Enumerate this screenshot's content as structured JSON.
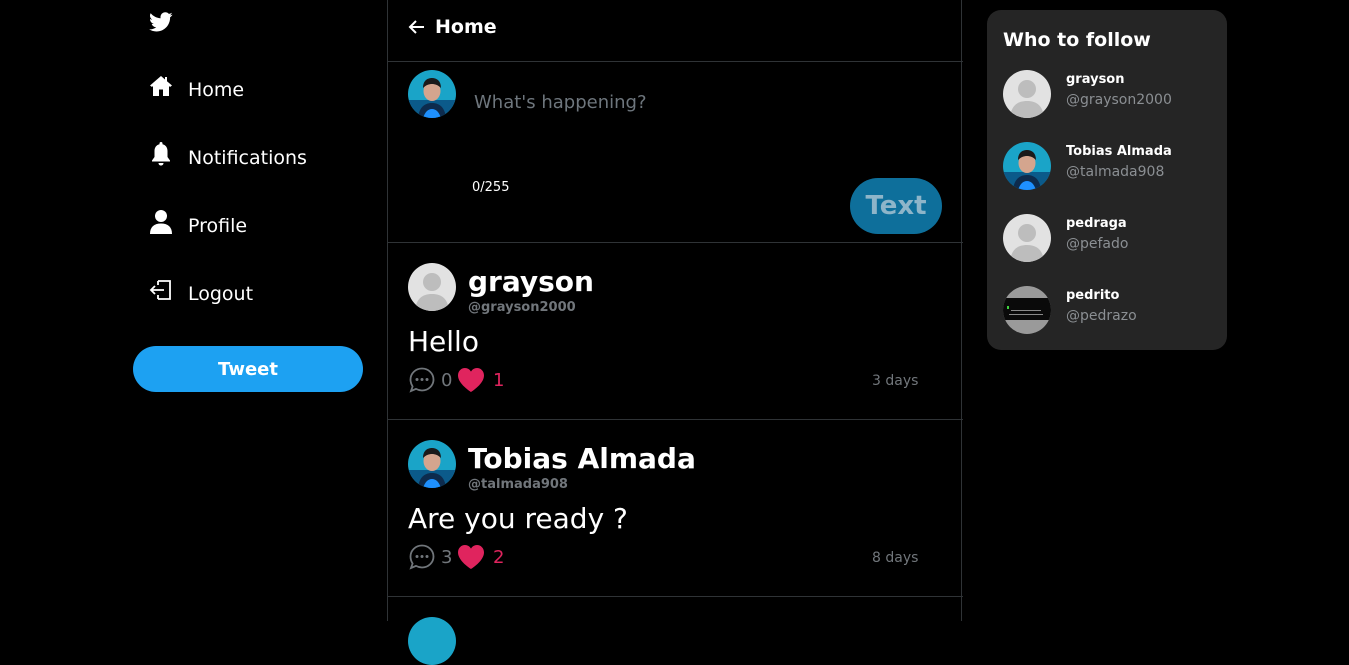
{
  "nav": {
    "items": [
      {
        "label": "Home",
        "icon": "home-icon"
      },
      {
        "label": "Notifications",
        "icon": "bell-icon"
      },
      {
        "label": "Profile",
        "icon": "user-icon"
      },
      {
        "label": "Logout",
        "icon": "logout-icon"
      }
    ],
    "tweet_label": "Tweet"
  },
  "header": {
    "title": "Home"
  },
  "composer": {
    "placeholder": "What's happening?",
    "counter": "0/255",
    "submit_label": "Text"
  },
  "posts": [
    {
      "name": "grayson",
      "handle": "@grayson2000",
      "text": "Hello",
      "comments": "0",
      "likes": "1",
      "time": "3 days"
    },
    {
      "name": "Tobias Almada",
      "handle": "@talmada908",
      "text": "Are you ready ?",
      "comments": "3",
      "likes": "2",
      "time": "8 days"
    }
  ],
  "follow": {
    "title": "Who to follow",
    "users": [
      {
        "name": "grayson",
        "handle": "@grayson2000"
      },
      {
        "name": "Tobias Almada",
        "handle": "@talmada908"
      },
      {
        "name": "pedraga",
        "handle": "@pefado"
      },
      {
        "name": "pedrito",
        "handle": "@pedrazo"
      }
    ]
  },
  "colors": {
    "accent": "#1da1f2",
    "like": "#e0245e",
    "panel": "#252525"
  }
}
